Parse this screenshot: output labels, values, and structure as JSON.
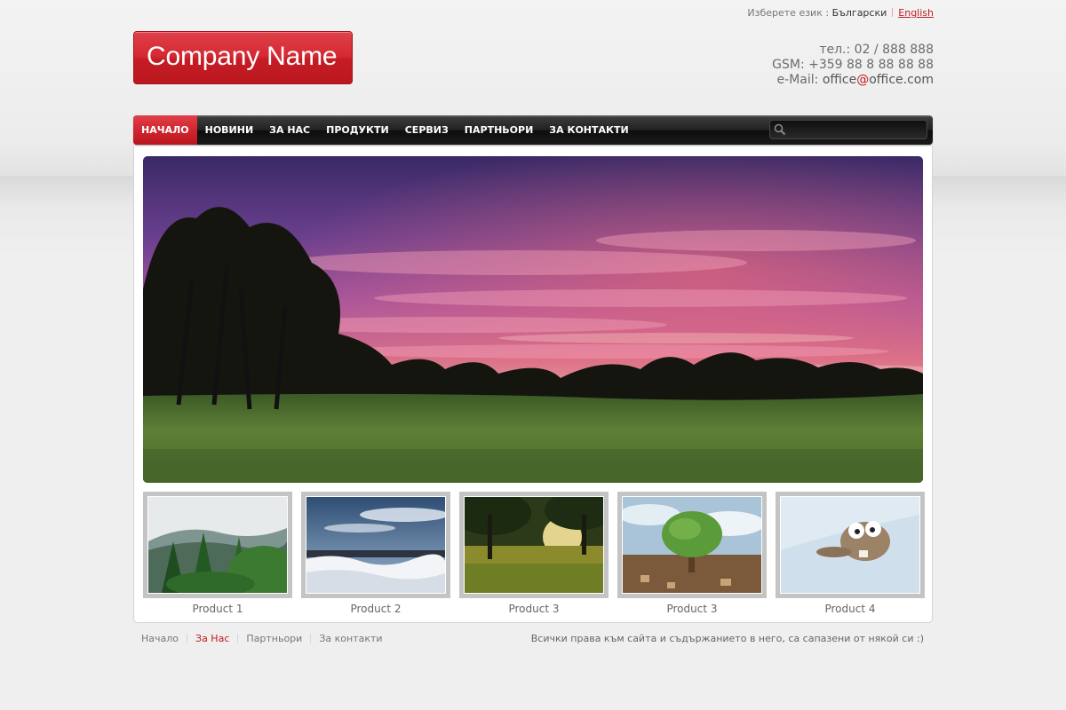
{
  "language_bar": {
    "prompt": "Изберете език :",
    "bulgarian": "Български",
    "english": "English"
  },
  "logo": {
    "text": "Company Name"
  },
  "contacts": {
    "phone": "тел.: 02 / 888 888",
    "gsm": "GSM: +359 88 8 88 88 88",
    "email_label": "e-Mail: ",
    "email_user": "office",
    "email_at": "@",
    "email_domain": "office.com"
  },
  "nav": {
    "items": [
      {
        "label": "НАЧАЛО",
        "active": true
      },
      {
        "label": "НОВИНИ",
        "active": false
      },
      {
        "label": "ЗА НАС",
        "active": false
      },
      {
        "label": "ПРОДУКТИ",
        "active": false
      },
      {
        "label": "СЕРВИЗ",
        "active": false
      },
      {
        "label": "ПАРТНЬОРИ",
        "active": false
      },
      {
        "label": "ЗА КОНТАКТИ",
        "active": false
      }
    ],
    "search_value": ""
  },
  "products": [
    {
      "caption": "Product 1"
    },
    {
      "caption": "Product 2"
    },
    {
      "caption": "Product 3"
    },
    {
      "caption": "Product 3"
    },
    {
      "caption": "Product 4"
    }
  ],
  "footer": {
    "links": [
      "Начало",
      "За Нас",
      "Партньори",
      "За контакти"
    ],
    "active_index": 1,
    "copyright": "Всички права към сайта и съдържанието в него, са сапазени от някой си :)"
  },
  "colors": {
    "accent": "#c21a1f",
    "nav_bg": "#1a1a1a",
    "page_bg": "#efefef"
  },
  "icons": {
    "search": "search-icon"
  }
}
